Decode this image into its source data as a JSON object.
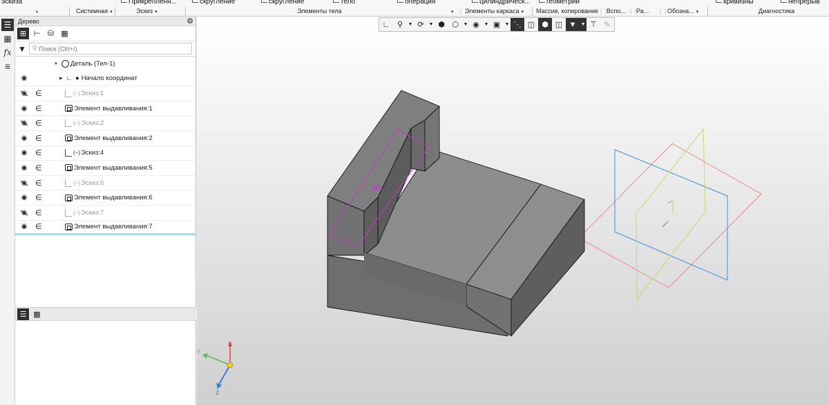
{
  "ribbon": {
    "groups": [
      {
        "top": "эскиза",
        "label": ""
      },
      {
        "top": "",
        "label": "Системная"
      },
      {
        "top": "Прикрепленн...",
        "label": "Эскиз"
      },
      {
        "top": "скругление",
        "label": ""
      },
      {
        "top": "скругление",
        "label": "Элементы тела"
      },
      {
        "top": "тело",
        "label": ""
      },
      {
        "top": "операция",
        "label": ""
      },
      {
        "top": "цилиндрическ...",
        "label": "Элементы каркаса"
      },
      {
        "top": "геометрии",
        "label": "Массив, копирование"
      },
      {
        "top": "",
        "label": "Вспо..."
      },
      {
        "top": "",
        "label": "Ра..."
      },
      {
        "top": "",
        "label": "Обозна..."
      },
      {
        "top": "кривизны",
        "label": "Диагностика"
      },
      {
        "top": "непрерыв",
        "label": ""
      }
    ]
  },
  "iconstrip": {
    "items": [
      {
        "icon": "tree-icon",
        "active": true
      },
      {
        "icon": "properties-icon",
        "active": false
      },
      {
        "icon": "fx-icon",
        "label": "fx",
        "active": false
      },
      {
        "icon": "layers-icon",
        "active": false
      }
    ]
  },
  "tree_panel": {
    "title": "Дерево",
    "search_placeholder": "Поиск (Ctrl+/)",
    "toolbar_icons": [
      "tree-build-icon",
      "tree-structure-icon",
      "tree-components-icon",
      "tree-selection-icon"
    ],
    "root": {
      "label": "Деталь (Тел-1)"
    },
    "origin": {
      "label": "Начало координат"
    },
    "items": [
      {
        "label": "Эскиз:1",
        "type": "sketch",
        "visible": false
      },
      {
        "label": "Элемент выдавливания:1",
        "type": "extrude",
        "visible": true
      },
      {
        "label": "Эскиз:2",
        "type": "sketch",
        "visible": false
      },
      {
        "label": "Элемент выдавливания:2",
        "type": "extrude",
        "visible": true
      },
      {
        "label": "Эскиз:4",
        "type": "sketch",
        "visible": true
      },
      {
        "label": "Элемент выдавливания:5",
        "type": "extrude",
        "visible": true
      },
      {
        "label": "Эскиз:6",
        "type": "sketch",
        "visible": false
      },
      {
        "label": "Элемент выдавливания:6",
        "type": "extrude",
        "visible": true
      },
      {
        "label": "Эскиз:7",
        "type": "sketch",
        "visible": false
      },
      {
        "label": "Элемент выдавливания:7",
        "type": "extrude",
        "visible": true
      }
    ],
    "bottom_tabs": [
      "tree-tab-icon",
      "properties-tab-icon"
    ]
  },
  "viewport_toolbar": {
    "buttons": [
      {
        "icon": "orientation-icon"
      },
      {
        "icon": "zoom-icon"
      },
      {
        "icon": "rotate-icon"
      },
      {
        "icon": "shaded-with-edges-icon",
        "active": false
      },
      {
        "icon": "wireframe-icon"
      },
      {
        "icon": "hide-icon"
      },
      {
        "icon": "display-mode-icon"
      },
      {
        "icon": "perspective-icon"
      },
      {
        "icon": "section-icon"
      },
      {
        "icon": "appearance-icon"
      },
      {
        "icon": "filter-icon",
        "active": true
      },
      {
        "icon": "measure-icon"
      },
      {
        "icon": "pencil-icon",
        "disabled": true
      }
    ]
  },
  "axes": {
    "x": "X",
    "y": "Y",
    "z": "Z"
  },
  "colors": {
    "model_face": "#8a8a8a",
    "sketch_magenta": "#cc33cc",
    "plane_red": "#f08080",
    "plane_blue": "#3d8fdc",
    "plane_green": "#b6e35a",
    "selection_cyan": "#a7dde9"
  }
}
